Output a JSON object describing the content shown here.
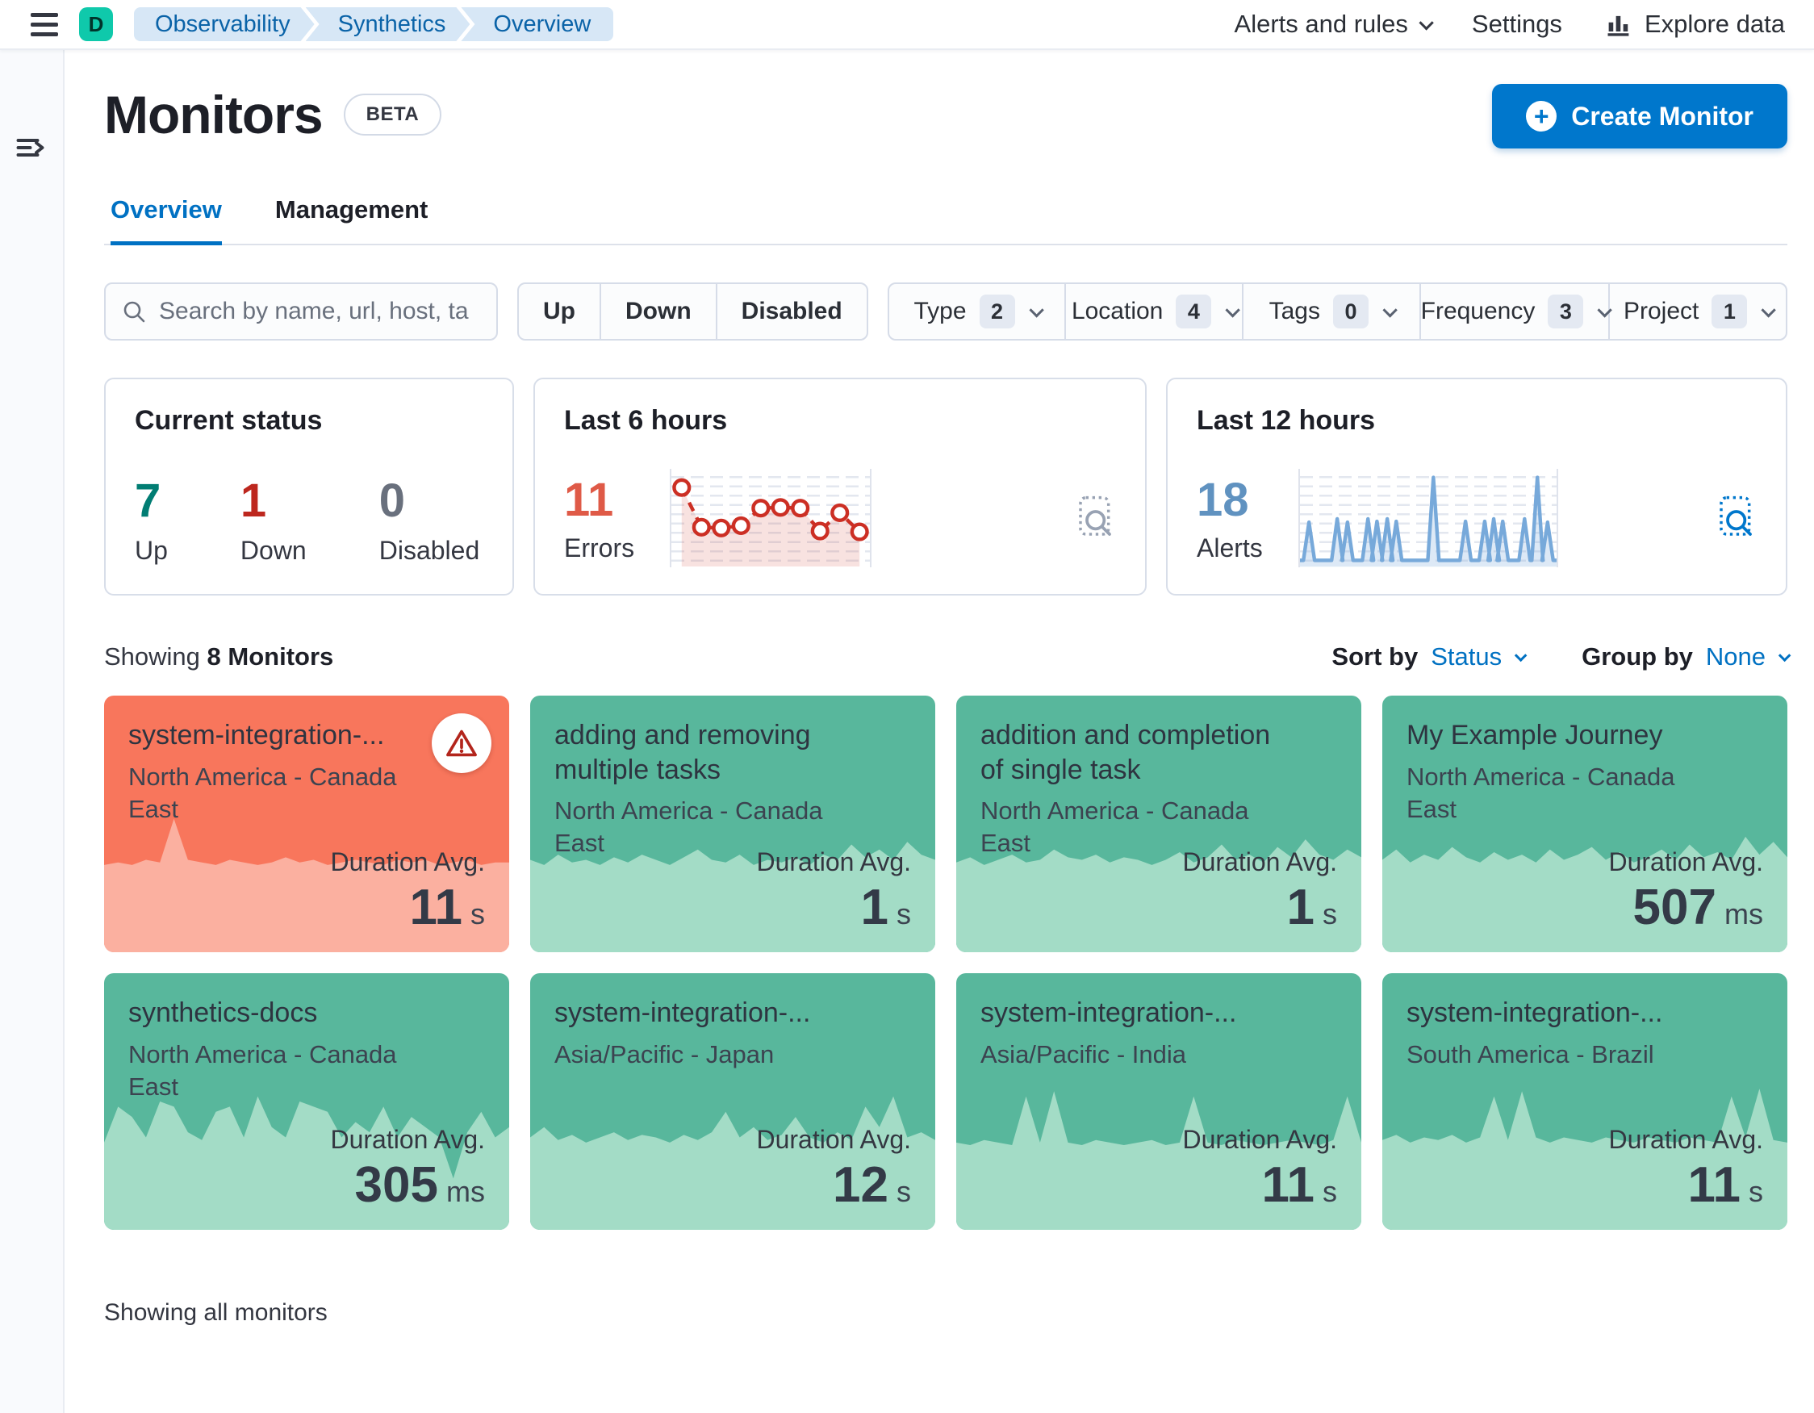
{
  "header": {
    "avatar_initial": "D",
    "breadcrumbs": [
      "Observability",
      "Synthetics",
      "Overview"
    ],
    "nav": {
      "alerts": "Alerts and rules",
      "settings": "Settings",
      "explore": "Explore data"
    }
  },
  "page": {
    "title": "Monitors",
    "beta_badge": "BETA",
    "create_button": "Create Monitor",
    "tabs": [
      {
        "label": "Overview",
        "active": true
      },
      {
        "label": "Management",
        "active": false
      }
    ]
  },
  "filters": {
    "search_placeholder": "Search by name, url, host, ta",
    "status_buttons": [
      "Up",
      "Down",
      "Disabled"
    ],
    "dropdowns": [
      {
        "label": "Type",
        "count": 2
      },
      {
        "label": "Location",
        "count": 4
      },
      {
        "label": "Tags",
        "count": 0
      },
      {
        "label": "Frequency",
        "count": 3
      },
      {
        "label": "Project",
        "count": 1
      }
    ]
  },
  "stats": {
    "current_status": {
      "title": "Current status",
      "items": [
        {
          "value": 7,
          "label": "Up",
          "color": "#017d73"
        },
        {
          "value": 1,
          "label": "Down",
          "color": "#bd271e"
        },
        {
          "value": 0,
          "label": "Disabled",
          "color": "#69707d"
        }
      ]
    },
    "last6": {
      "title": "Last 6 hours",
      "value": 11,
      "label": "Errors",
      "chart": {
        "type": "line",
        "color": "#cc2f24",
        "points": [
          0.9,
          0.38,
          0.37,
          0.4,
          0.63,
          0.64,
          0.63,
          0.33,
          0.57,
          0.32
        ]
      }
    },
    "last12": {
      "title": "Last 12 hours",
      "value": 18,
      "label": "Alerts",
      "chart": {
        "type": "line",
        "color": "#77a9da",
        "spikes": [
          [
            0.035,
            0.46
          ],
          [
            0.145,
            0.5
          ],
          [
            0.185,
            0.46
          ],
          [
            0.265,
            0.5
          ],
          [
            0.3,
            0.47
          ],
          [
            0.34,
            0.5
          ],
          [
            0.375,
            0.47
          ],
          [
            0.52,
            1.0
          ],
          [
            0.645,
            0.47
          ],
          [
            0.72,
            0.47
          ],
          [
            0.755,
            0.5
          ],
          [
            0.79,
            0.47
          ],
          [
            0.875,
            0.5
          ],
          [
            0.925,
            1.0
          ],
          [
            0.965,
            0.46
          ]
        ]
      }
    }
  },
  "monitors": {
    "showing_prefix": "Showing",
    "showing_count": "8 Monitors",
    "sort_by": {
      "label": "Sort by",
      "value": "Status"
    },
    "group_by": {
      "label": "Group by",
      "value": "None"
    },
    "footer": "Showing all monitors",
    "cards": [
      {
        "name": "system-integration-...",
        "location": "North America - Canada East",
        "metric_label": "Duration Avg.",
        "value": "11",
        "unit": "s",
        "status": "down",
        "sparkline": [
          0.34,
          0.35,
          0.34,
          0.36,
          0.35,
          0.52,
          0.36,
          0.35,
          0.34,
          0.36,
          0.35,
          0.34,
          0.35,
          0.37,
          0.35,
          0.36,
          0.34,
          0.35,
          0.36,
          0.35,
          0.34,
          0.36,
          0.35,
          0.36,
          0.34,
          0.35,
          0.36,
          0.34,
          0.35,
          0.35
        ]
      },
      {
        "name": "adding and removing multiple tasks",
        "location": "North America - Canada East",
        "metric_label": "Duration Avg.",
        "value": "1",
        "unit": "s",
        "status": "up",
        "sparkline": [
          0.36,
          0.34,
          0.38,
          0.35,
          0.36,
          0.34,
          0.37,
          0.35,
          0.38,
          0.36,
          0.34,
          0.37,
          0.4,
          0.36,
          0.35,
          0.38,
          0.34,
          0.36,
          0.35,
          0.37,
          0.34,
          0.38,
          0.36,
          0.42,
          0.37,
          0.4,
          0.36,
          0.43,
          0.38,
          0.36
        ]
      },
      {
        "name": "addition and completion of single task",
        "location": "North America - Canada East",
        "metric_label": "Duration Avg.",
        "value": "1",
        "unit": "s",
        "status": "up",
        "sparkline": [
          0.35,
          0.37,
          0.34,
          0.36,
          0.38,
          0.35,
          0.36,
          0.4,
          0.37,
          0.36,
          0.38,
          0.35,
          0.37,
          0.36,
          0.34,
          0.36,
          0.39,
          0.35,
          0.37,
          0.42,
          0.36,
          0.38,
          0.35,
          0.41,
          0.37,
          0.44,
          0.38,
          0.36,
          0.4,
          0.37
        ]
      },
      {
        "name": "My Example Journey",
        "location": "North America - Canada East",
        "metric_label": "Duration Avg.",
        "value": "507",
        "unit": "ms",
        "status": "up",
        "sparkline": [
          0.36,
          0.4,
          0.35,
          0.38,
          0.36,
          0.41,
          0.37,
          0.35,
          0.39,
          0.36,
          0.38,
          0.35,
          0.4,
          0.36,
          0.38,
          0.41,
          0.36,
          0.39,
          0.35,
          0.37,
          0.4,
          0.36,
          0.42,
          0.37,
          0.39,
          0.36,
          0.45,
          0.38,
          0.43,
          0.37
        ]
      },
      {
        "name": "synthetics-docs",
        "location": "North America - Canada East",
        "metric_label": "Duration Avg.",
        "value": "305",
        "unit": "ms",
        "status": "up",
        "sparkline": [
          0.34,
          0.48,
          0.44,
          0.36,
          0.5,
          0.48,
          0.38,
          0.35,
          0.46,
          0.48,
          0.36,
          0.52,
          0.4,
          0.36,
          0.5,
          0.48,
          0.46,
          0.36,
          0.42,
          0.38,
          0.48,
          0.36,
          0.44,
          0.4,
          0.36,
          0.2,
          0.38,
          0.46,
          0.36,
          0.4
        ]
      },
      {
        "name": "system-integration-...",
        "location": "Asia/Pacific - Japan",
        "metric_label": "Duration Avg.",
        "value": "12",
        "unit": "s",
        "status": "up",
        "sparkline": [
          0.36,
          0.4,
          0.35,
          0.37,
          0.34,
          0.36,
          0.38,
          0.35,
          0.37,
          0.36,
          0.34,
          0.37,
          0.35,
          0.38,
          0.46,
          0.36,
          0.4,
          0.35,
          0.37,
          0.44,
          0.36,
          0.34,
          0.38,
          0.35,
          0.48,
          0.4,
          0.52,
          0.36,
          0.38,
          0.35
        ]
      },
      {
        "name": "system-integration-...",
        "location": "Asia/Pacific - India",
        "metric_label": "Duration Avg.",
        "value": "11",
        "unit": "s",
        "status": "up",
        "sparkline": [
          0.34,
          0.33,
          0.35,
          0.34,
          0.33,
          0.52,
          0.34,
          0.54,
          0.34,
          0.33,
          0.35,
          0.34,
          0.33,
          0.34,
          0.35,
          0.33,
          0.34,
          0.52,
          0.34,
          0.33,
          0.35,
          0.34,
          0.33,
          0.34,
          0.35,
          0.34,
          0.33,
          0.35,
          0.52,
          0.34
        ]
      },
      {
        "name": "system-integration-...",
        "location": "South America - Brazil",
        "metric_label": "Duration Avg.",
        "value": "11",
        "unit": "s",
        "status": "up",
        "sparkline": [
          0.35,
          0.37,
          0.34,
          0.36,
          0.35,
          0.37,
          0.34,
          0.36,
          0.52,
          0.35,
          0.54,
          0.36,
          0.34,
          0.36,
          0.35,
          0.34,
          0.36,
          0.35,
          0.34,
          0.36,
          0.35,
          0.34,
          0.36,
          0.35,
          0.34,
          0.52,
          0.36,
          0.55,
          0.35,
          0.34
        ]
      }
    ]
  },
  "colors": {
    "brand_primary": "#0077cc",
    "avatar": "#0fc9ab",
    "breadcrumb_bg": "#d7e7f6",
    "breadcrumb_text": "#0a63a8",
    "up_text": "#017d73",
    "down_text": "#bd271e",
    "disabled_text": "#69707d",
    "errors_text": "#df5a47",
    "alerts_text": "#6092c0",
    "error_line": "#cc2f24",
    "alert_line": "#77a9da",
    "card_up_bg": "#58b79c",
    "card_up_area": "#a3dcc6",
    "card_down_bg": "#f8765c",
    "card_down_area": "#fbb0a0"
  }
}
